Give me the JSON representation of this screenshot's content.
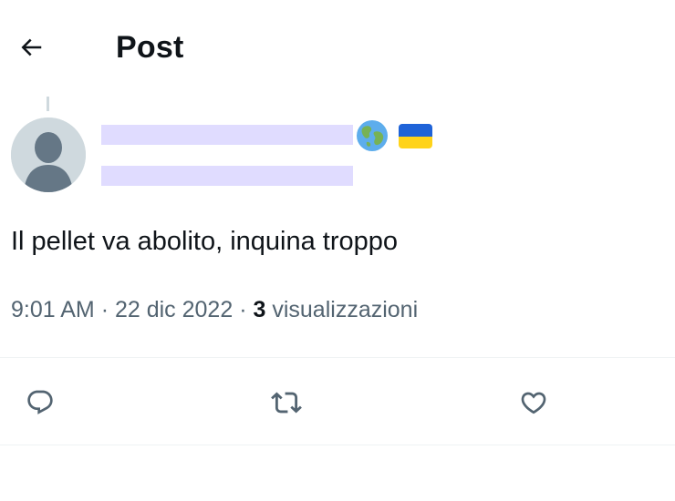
{
  "header": {
    "title": "Post",
    "back_icon": "arrow-left-icon"
  },
  "author": {
    "avatar_icon": "default-avatar-icon",
    "badges": [
      "globe-emoji-icon",
      "ukraine-flag-icon"
    ],
    "flag_colors": {
      "top": "#1f63d8",
      "bottom": "#ffd31a"
    }
  },
  "post": {
    "text": "Il pellet va abolito, inquina troppo",
    "time": "9:01 AM",
    "separator": "·",
    "date": "22 dic 2022",
    "views_count": "3",
    "views_label": "visualizzazioni"
  },
  "actions": [
    {
      "name": "reply",
      "icon": "reply-icon"
    },
    {
      "name": "repost",
      "icon": "retweet-icon"
    },
    {
      "name": "like",
      "icon": "heart-icon"
    }
  ],
  "colors": {
    "text": "#0f1419",
    "secondary": "#536471",
    "divider": "#eff3f4",
    "redaction": "#e0dcff"
  }
}
